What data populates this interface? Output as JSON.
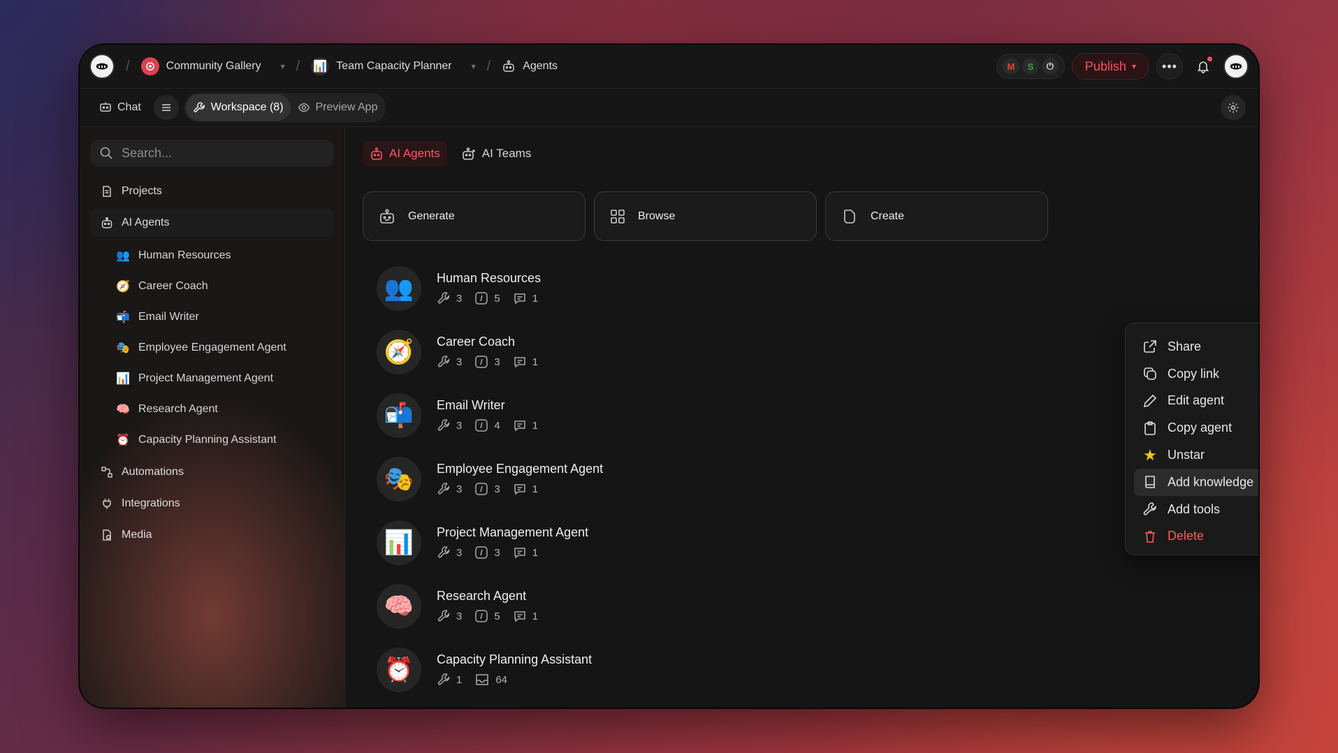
{
  "breadcrumbs": [
    {
      "label": "Community Gallery"
    },
    {
      "label": "Team Capacity Planner"
    },
    {
      "label": "Agents"
    }
  ],
  "top_right": {
    "integrations": [
      "M",
      "S",
      "⏻"
    ],
    "publish_label": "Publish"
  },
  "toolbar": {
    "chat_label": "Chat",
    "workspace_label": "Workspace (8)",
    "preview_label": "Preview App"
  },
  "sidebar": {
    "search_placeholder": "Search...",
    "projects_label": "Projects",
    "ai_agents_label": "AI Agents",
    "agent_items": [
      {
        "emoji": "👥",
        "label": "Human Resources"
      },
      {
        "emoji": "🧭",
        "label": "Career Coach"
      },
      {
        "emoji": "📬",
        "label": "Email Writer"
      },
      {
        "emoji": "🎭",
        "label": "Employee Engagement Agent"
      },
      {
        "emoji": "📊",
        "label": "Project Management Agent"
      },
      {
        "emoji": "🧠",
        "label": "Research Agent"
      },
      {
        "emoji": "⏰",
        "label": "Capacity Planning Assistant"
      }
    ],
    "automations_label": "Automations",
    "integrations_label": "Integrations",
    "media_label": "Media"
  },
  "main": {
    "tabs": [
      {
        "label": "AI Agents"
      },
      {
        "label": "AI Teams"
      }
    ],
    "actions": [
      {
        "label": "Generate"
      },
      {
        "label": "Browse"
      },
      {
        "label": "Create"
      }
    ],
    "agents": [
      {
        "emoji": "👥",
        "name": "Human Resources",
        "tools": "3",
        "instructions": "5",
        "chats": "1"
      },
      {
        "emoji": "🧭",
        "name": "Career Coach",
        "tools": "3",
        "instructions": "3",
        "chats": "1"
      },
      {
        "emoji": "📬",
        "name": "Email Writer",
        "tools": "3",
        "instructions": "4",
        "chats": "1"
      },
      {
        "emoji": "🎭",
        "name": "Employee Engagement Agent",
        "tools": "3",
        "instructions": "3",
        "chats": "1"
      },
      {
        "emoji": "📊",
        "name": "Project Management Agent",
        "tools": "3",
        "instructions": "3",
        "chats": "1"
      },
      {
        "emoji": "🧠",
        "name": "Research Agent",
        "tools": "3",
        "instructions": "5",
        "chats": "1"
      },
      {
        "emoji": "⏰",
        "name": "Capacity Planning Assistant",
        "tools": "1",
        "inbox": "64"
      }
    ]
  },
  "context_menu": {
    "items": [
      {
        "label": "Share"
      },
      {
        "label": "Copy link"
      },
      {
        "label": "Edit agent"
      },
      {
        "label": "Copy agent"
      },
      {
        "label": "Unstar"
      },
      {
        "label": "Add knowledge"
      },
      {
        "label": "Add tools"
      },
      {
        "label": "Delete"
      }
    ]
  },
  "colors": {
    "accent": "#ff4d5e",
    "danger": "#ff5a5a",
    "window_bg": "#151515"
  }
}
